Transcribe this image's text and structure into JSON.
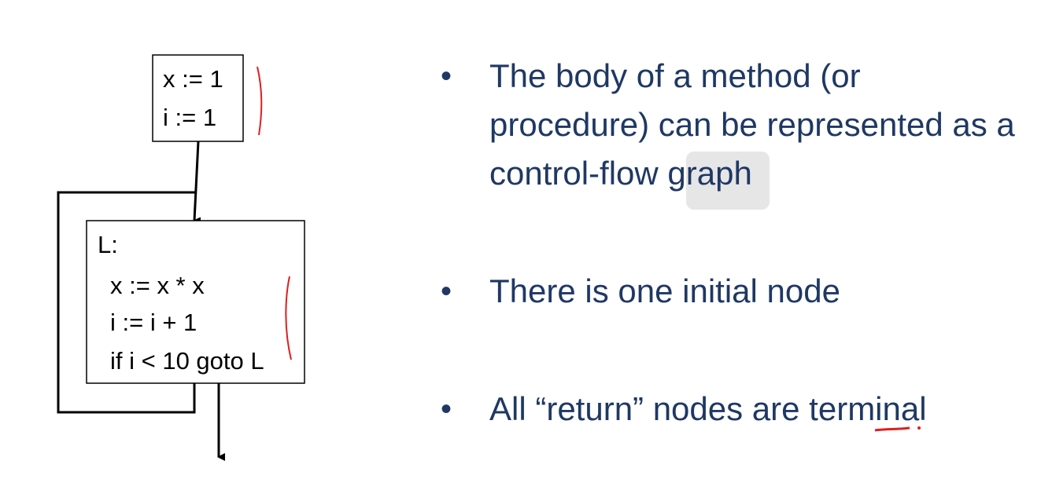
{
  "diagram": {
    "entry_block": {
      "lines": [
        "x := 1",
        "i := 1"
      ]
    },
    "loop_block": {
      "lines": [
        "L:",
        "x := x * x",
        "i := i + 1",
        "if i < 10 goto L"
      ]
    }
  },
  "bullets": [
    {
      "dot": "•",
      "text": "The body of a method (or procedure) can be represented as a control-flow graph"
    },
    {
      "dot": "•",
      "text": "There is one initial node"
    },
    {
      "dot": "•",
      "text": "All “return” nodes are terminal"
    }
  ],
  "colors": {
    "bullet_text": "#1f3864",
    "annotation": "#e01e1e"
  }
}
